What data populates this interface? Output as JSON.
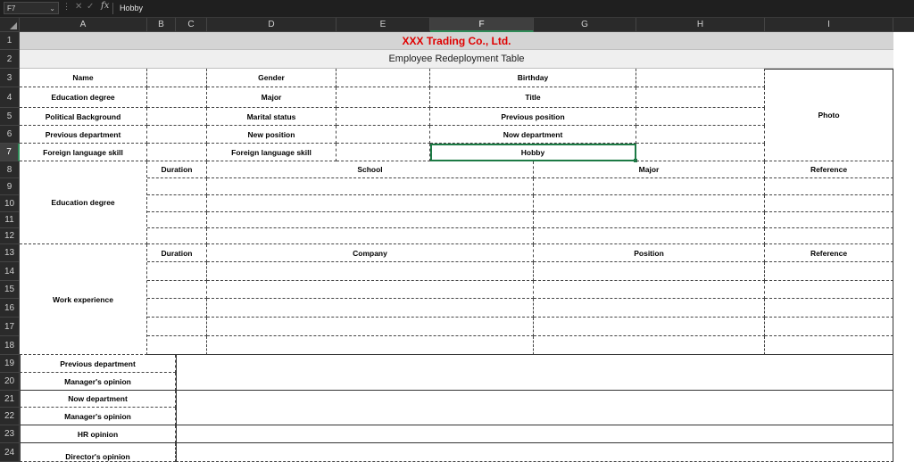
{
  "formula_bar": {
    "name_box": "F7",
    "formula_value": "Hobby"
  },
  "columns": [
    "A",
    "B",
    "C",
    "D",
    "E",
    "F",
    "G",
    "H",
    "I"
  ],
  "rows": [
    "1",
    "2",
    "3",
    "4",
    "5",
    "6",
    "7",
    "8",
    "9",
    "10",
    "11",
    "12",
    "13",
    "14",
    "15",
    "16",
    "17",
    "18",
    "19",
    "20",
    "21",
    "22",
    "23",
    "24"
  ],
  "sheet": {
    "company_title": "XXX Trading Co., Ltd.",
    "table_title": "Employee Redeployment Table",
    "info_labels": {
      "name": "Name",
      "education_degree": "Education degree",
      "political_background": "Political Background",
      "previous_department": "Previous department",
      "foreign_language_skill": "Foreign language skill",
      "gender": "Gender",
      "major": "Major",
      "marital_status": "Marital status",
      "new_position": "New position",
      "foreign_language_skill_2": "Foreign language skill",
      "birthday": "Birthday",
      "title": "Title",
      "previous_position": "Previous position",
      "now_department": "Now department",
      "hobby": "Hobby",
      "photo": "Photo"
    },
    "education": {
      "section_label": "Education degree",
      "headers": [
        "Duration",
        "School",
        "Major",
        "Reference"
      ]
    },
    "work": {
      "section_label": "Work experience",
      "headers": [
        "Duration",
        "Company",
        "Position",
        "Reference"
      ]
    },
    "opinions": [
      "Previous department",
      "Manager's opinion",
      "Now department",
      "Manager's opinion",
      "HR opinion",
      "Director's opinion"
    ]
  },
  "colors": {
    "title_red": "#e00000",
    "selection_green": "#1d7a45"
  }
}
